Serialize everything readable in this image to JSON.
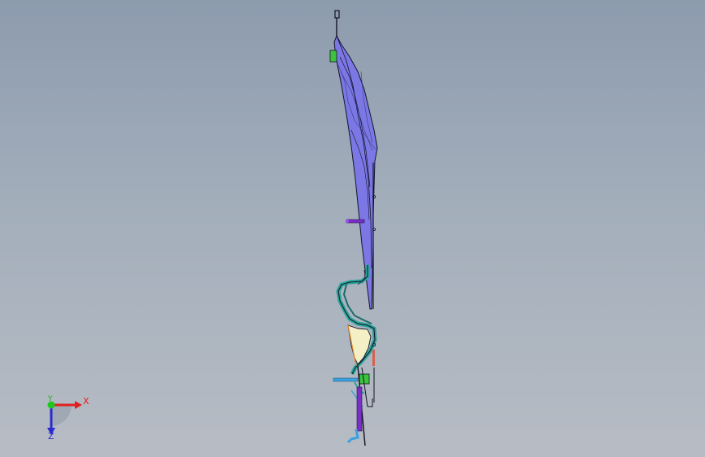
{
  "viewport": {
    "background_top": "#8d9bae",
    "background_bottom": "#b7bcc4"
  },
  "model": {
    "part_colors": {
      "main_body": "#7b78e6",
      "wire": "#141428",
      "teal_panel": "#2aa59a",
      "cream_panel": "#f5efc6",
      "green_tab": "#3cc43c",
      "purple_pin": "#7a2fc8",
      "cyan_pin": "#3aa0e0",
      "orange_edge": "#e08a2a"
    }
  },
  "triad": {
    "x_label": "X",
    "y_label": "Y",
    "z_label": "Z",
    "x_color": "#e02020",
    "y_color": "#1fa81f",
    "z_color": "#2a2ad0"
  }
}
